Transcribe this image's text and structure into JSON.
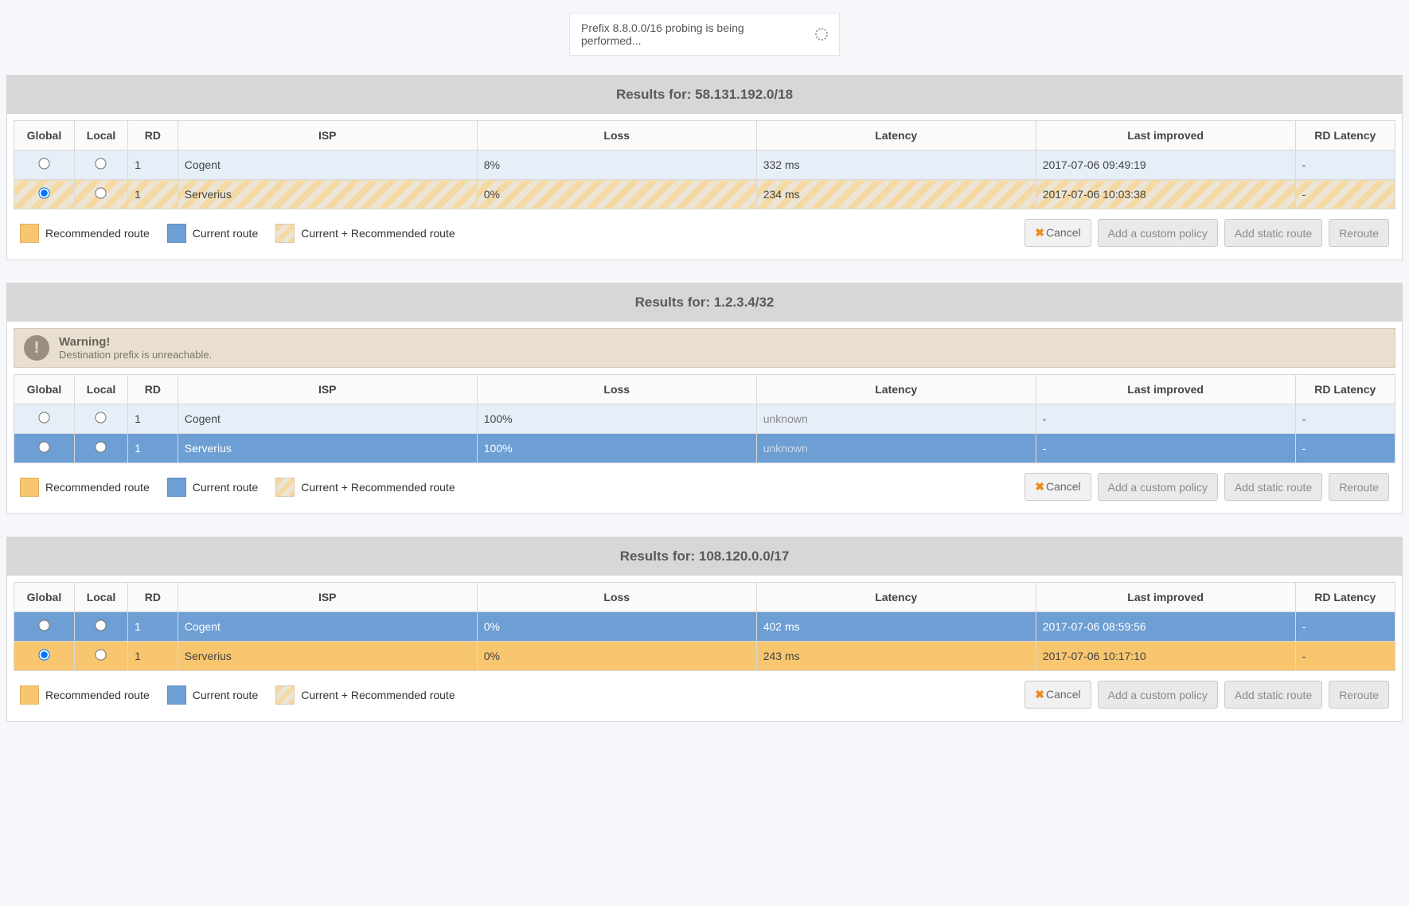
{
  "probe_status": "Prefix 8.8.0.0/16 probing is being performed...",
  "columns": {
    "global": "Global",
    "local": "Local",
    "rd": "RD",
    "isp": "ISP",
    "loss": "Loss",
    "latency": "Latency",
    "last_improved": "Last improved",
    "rd_latency": "RD Latency"
  },
  "legend": {
    "recommended": "Recommended route",
    "current": "Current route",
    "both": "Current + Recommended route"
  },
  "actions": {
    "cancel": "Cancel",
    "add_policy": "Add a custom policy",
    "add_static": "Add static route",
    "reroute": "Reroute"
  },
  "panels": [
    {
      "title": "Results for: 58.131.192.0/18",
      "warning": null,
      "rows": [
        {
          "style": "row-current",
          "global_checked": false,
          "local_checked": false,
          "rd": "1",
          "isp": "Cogent",
          "loss": "8%",
          "latency": "332 ms",
          "last_improved": "2017-07-06 09:49:19",
          "rd_latency": "-",
          "latency_muted": false
        },
        {
          "style": "row-both",
          "global_checked": true,
          "local_checked": false,
          "rd": "1",
          "isp": "Serverius",
          "loss": "0%",
          "latency": "234 ms",
          "last_improved": "2017-07-06 10:03:38",
          "rd_latency": "-",
          "latency_muted": false
        }
      ]
    },
    {
      "title": "Results for: 1.2.3.4/32",
      "warning": {
        "title": "Warning!",
        "message": "Destination prefix is unreachable."
      },
      "rows": [
        {
          "style": "row-current",
          "global_checked": false,
          "local_checked": false,
          "rd": "1",
          "isp": "Cogent",
          "loss": "100%",
          "latency": "unknown",
          "last_improved": "-",
          "rd_latency": "-",
          "latency_muted": true
        },
        {
          "style": "row-current-solid",
          "global_checked": false,
          "local_checked": false,
          "rd": "1",
          "isp": "Serverius",
          "loss": "100%",
          "latency": "unknown",
          "last_improved": "-",
          "rd_latency": "-",
          "latency_muted": true
        }
      ]
    },
    {
      "title": "Results for: 108.120.0.0/17",
      "warning": null,
      "rows": [
        {
          "style": "row-current-solid",
          "global_checked": false,
          "local_checked": false,
          "rd": "1",
          "isp": "Cogent",
          "loss": "0%",
          "latency": "402 ms",
          "last_improved": "2017-07-06 08:59:56",
          "rd_latency": "-",
          "latency_muted": false
        },
        {
          "style": "row-recommended",
          "global_checked": true,
          "local_checked": false,
          "rd": "1",
          "isp": "Serverius",
          "loss": "0%",
          "latency": "243 ms",
          "last_improved": "2017-07-06 10:17:10",
          "rd_latency": "-",
          "latency_muted": false
        }
      ]
    }
  ]
}
